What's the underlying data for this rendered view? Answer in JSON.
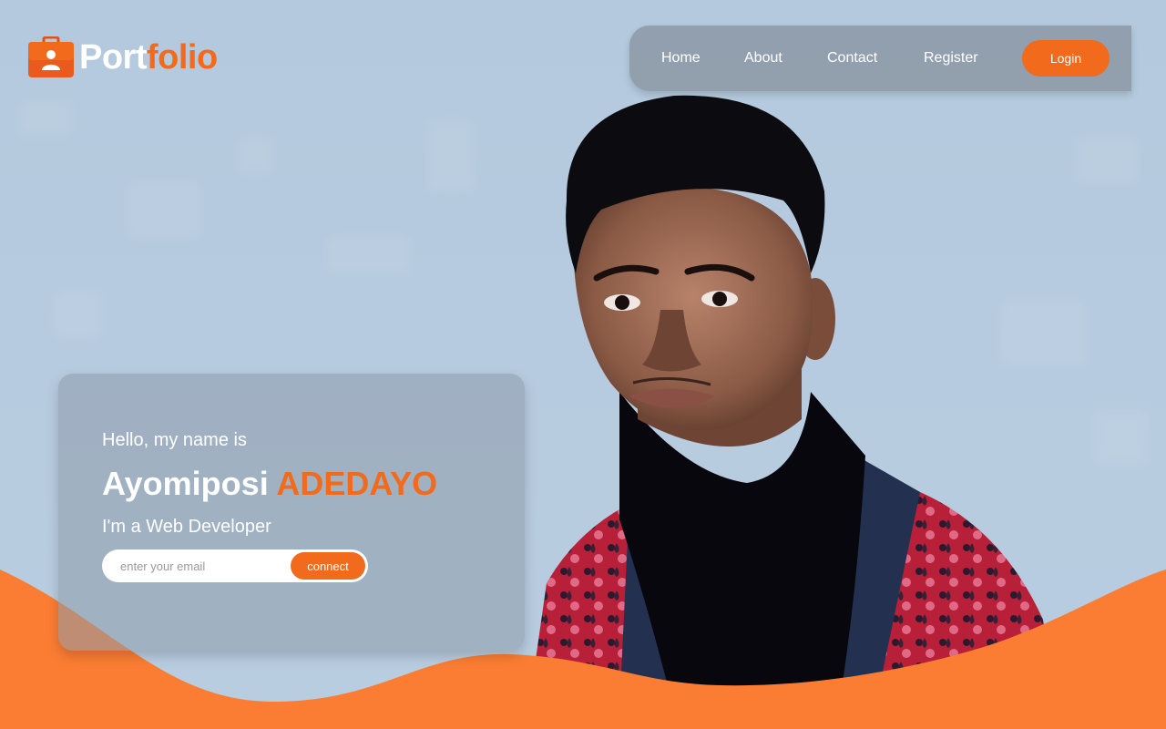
{
  "logo": {
    "text_part1": "Port",
    "text_part2": "folio",
    "icon": "briefcase-user-icon"
  },
  "nav": {
    "home": "Home",
    "about": "About",
    "contact": "Contact",
    "register": "Register",
    "login": "Login"
  },
  "hero": {
    "greeting": "Hello, my name is",
    "first_name": "Ayomiposi",
    "last_name": "ADEDAYO",
    "role": "I'm a Web Developer",
    "email_placeholder": "enter your email",
    "connect_label": "connect"
  },
  "colors": {
    "accent": "#f26a1b",
    "background": "#b7cbe0",
    "wave": "#fb7d33"
  }
}
